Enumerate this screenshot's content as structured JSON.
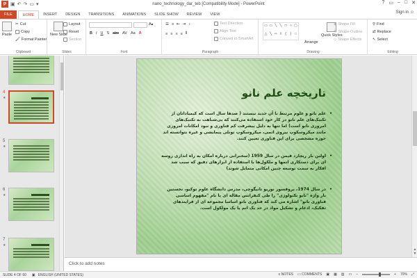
{
  "app": {
    "title": "nano_technology_dar_teb [Compatibility Mode] - PowerPoint",
    "logo": "P",
    "signin": "Sign in"
  },
  "tabs": [
    "FILE",
    "HOME",
    "INSERT",
    "DESIGN",
    "TRANSITIONS",
    "ANIMATIONS",
    "SLIDE SHOW",
    "REVIEW",
    "VIEW"
  ],
  "ribbon": {
    "clipboard": {
      "label": "Clipboard",
      "paste": "Paste",
      "cut": "Cut",
      "copy": "Copy",
      "format_painter": "Format Painter"
    },
    "slides": {
      "label": "Slides",
      "new_slide": "New Slide",
      "layout": "Layout",
      "reset": "Reset",
      "section": "Section"
    },
    "font": {
      "label": "Font"
    },
    "paragraph": {
      "label": "Paragraph",
      "text_direction": "Text Direction",
      "align_text": "Align Text",
      "convert": "Convert to SmartArt"
    },
    "drawing": {
      "label": "Drawing",
      "arrange": "Arrange",
      "quick_styles": "Quick Styles",
      "shape_fill": "Shape Fill",
      "shape_outline": "Shape Outline",
      "shape_effects": "Shape Effects"
    },
    "editing": {
      "label": "Editing",
      "find": "Find",
      "replace": "Replace",
      "select": "Select"
    }
  },
  "thumbnails": [
    {
      "num": "",
      "selected": false
    },
    {
      "num": "4",
      "selected": true
    },
    {
      "num": "5",
      "selected": false
    },
    {
      "num": "6",
      "selected": false
    },
    {
      "num": "7",
      "selected": false
    }
  ],
  "slide": {
    "title": "تاریخچه علم نانو",
    "para1": "علم نانو و علوم مرتبط با آن جدید نیستند ( صدها سال است که کیمیاداتان از تکنیک‌های علم نانو در کار خود استفاده می‌کنند که بی‌شباهت به تکنیک‌های امروزی نانو است) اما تنها به دلیل پیشرفت کم فناوری و نبود امکانات امروزی مانند میکروسکوپ نیروی اتمی، میکروسکوپ تونلی پیمایشی و غیره نتوانسته اند حوزه مشخصی برای این فناوری تعیین کنند.",
    "para2": "اولین بار ریچارد فیمن در سال 1959 (سخنرانی درباره امکان به راه اندازی روسه ای برای دستکاری اتمها و ملکول‌ها با استفاده از ابزارهای دقیق که سبب شد افکار به سمت توسعه چنین امکانی متمایل شوند)",
    "para3": "در سال 1974، پروفسور نوریو تانیگوچی، مدرس دانشگاه علوم توکیو، نخستین بار واژه \"نانو تکنولوژی\" را طی کنفرانس مقاله ای با نام \"مفهوم اساسی فناوری نانو\" اشاره می کند که فناوری نانو اساسا مجموعه ای از فرایندهای تفکیک، ادغام و تشکیل مواد در حد یک اتم یا یک مولکول است."
  },
  "notes": {
    "placeholder": "Click to add notes"
  },
  "status": {
    "slide": "SLIDE 4 OF 60",
    "language": "ENGLISH (UNITED STATES)",
    "notes": "NOTES",
    "comments": "COMMENTS",
    "zoom": "70%"
  }
}
